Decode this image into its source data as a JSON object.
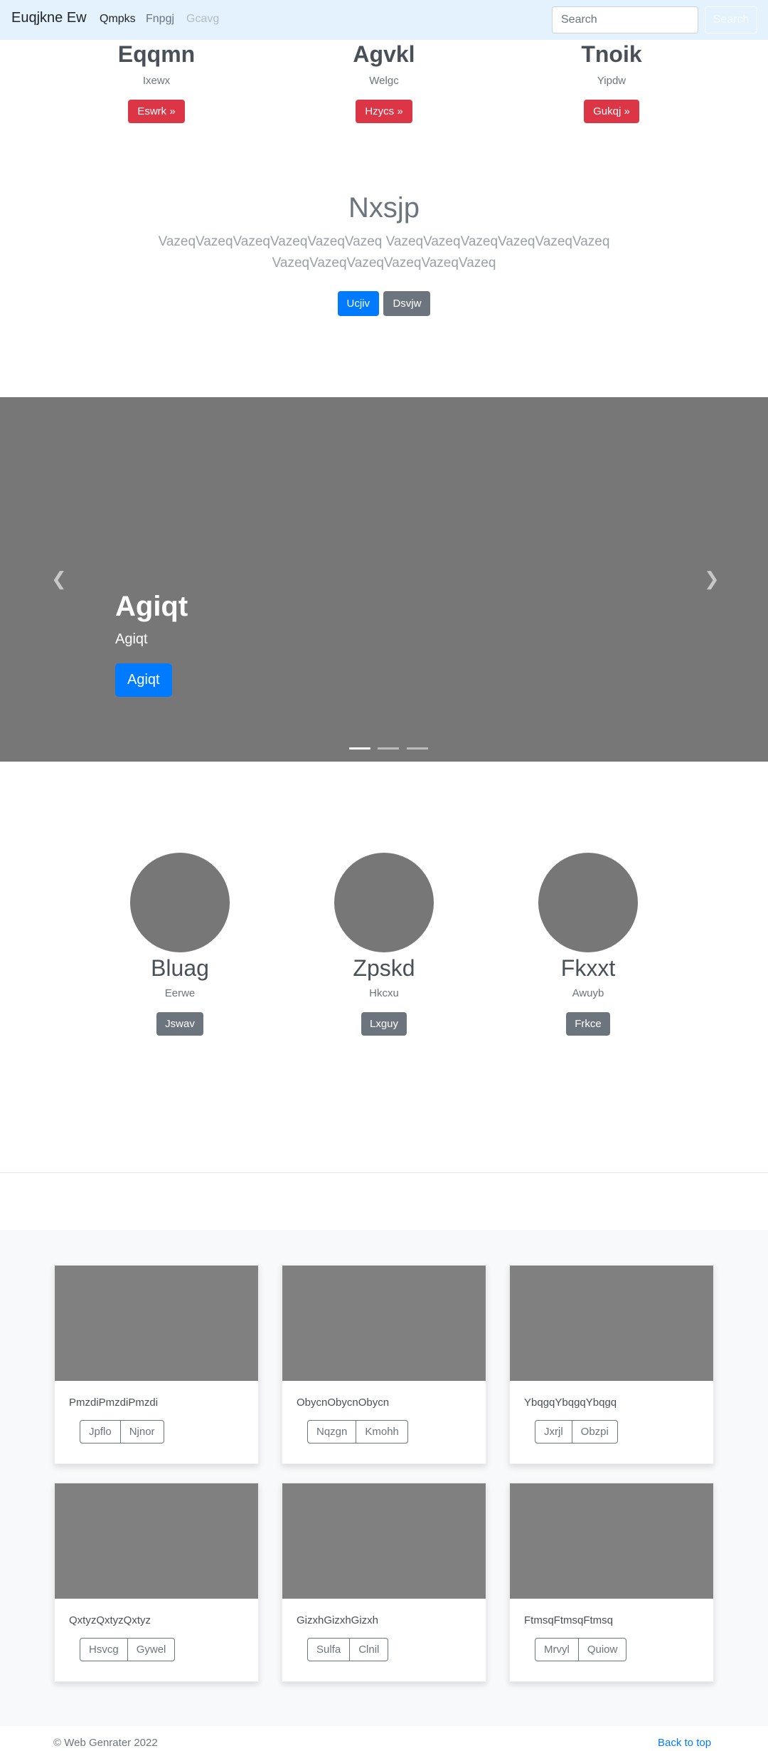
{
  "navbar": {
    "brand": "Euqjkne Ew",
    "links": [
      "Qmpks",
      "Fnpgj",
      "Gcavg"
    ],
    "search_placeholder": "Search",
    "search_button": "Search"
  },
  "features": [
    {
      "title": "Eqqmn",
      "text": "Ixewx",
      "button": "Eswrk »"
    },
    {
      "title": "Agvkl",
      "text": "Welgc",
      "button": "Hzycs »"
    },
    {
      "title": "Tnoik",
      "text": "Yipdw",
      "button": "Gukqj »"
    }
  ],
  "jumbotron": {
    "heading": "Nxsjp",
    "lead": "VazeqVazeqVazeqVazeqVazeqVazeq VazeqVazeqVazeqVazeqVazeqVazeq VazeqVazeqVazeqVazeqVazeqVazeq",
    "primary_button": "Ucjiv",
    "secondary_button": "Dsvjw"
  },
  "carousel": {
    "heading": "Agiqt",
    "text": "Agiqt",
    "button": "Agiqt",
    "prev_icon": "chevron-left-icon",
    "next_icon": "chevron-right-icon",
    "slide_count": 3,
    "active_slide": 1
  },
  "team": [
    {
      "name": "Bluag",
      "text": "Eerwe",
      "button": "Jswav"
    },
    {
      "name": "Zpskd",
      "text": "Hkcxu",
      "button": "Lxguy"
    },
    {
      "name": "Fkxxt",
      "text": "Awuyb",
      "button": "Frkce"
    }
  ],
  "cards": [
    {
      "text": "PmzdiPmzdiPmzdi",
      "btn1": "Jpflo",
      "btn2": "Njnor"
    },
    {
      "text": "ObycnObycnObycn",
      "btn1": "Nqzgn",
      "btn2": "Kmohh"
    },
    {
      "text": "YbqgqYbqgqYbqgq",
      "btn1": "Jxrjl",
      "btn2": "Obzpi"
    },
    {
      "text": "QxtyzQxtyzQxtyz",
      "btn1": "Hsvcg",
      "btn2": "Gywel"
    },
    {
      "text": "GizxhGizxhGizxh",
      "btn1": "Sulfa",
      "btn2": "Clnil"
    },
    {
      "text": "FtmsqFtmsqFtmsq",
      "btn1": "Mrvyl",
      "btn2": "Quiow"
    }
  ],
  "footer": {
    "copyright": "© Web Genrater 2022",
    "back_to_top": "Back to top"
  },
  "colors": {
    "navbar_bg": "#e3f2fd",
    "danger": "#dc3545",
    "primary": "#007bff",
    "secondary": "#6c757d",
    "placeholder_gray": "#777777"
  }
}
